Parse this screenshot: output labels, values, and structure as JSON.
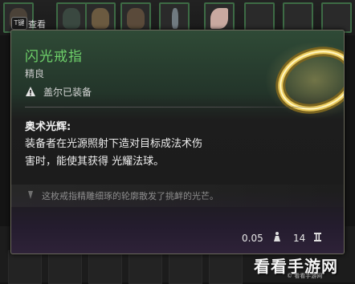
{
  "inventory": {
    "inspect_key": "T键",
    "inspect_label": "查看"
  },
  "tooltip": {
    "item_name": "闪光戒指",
    "rarity": "精良",
    "equipped_by": "盖尔已装备",
    "passive_title": "奥术光辉:",
    "passive_desc_line1": "装备者在光源照射下造对目标成法术伤",
    "passive_desc_line2_a": "害时，能使其获得 ",
    "passive_desc_keyword": "光耀法球。",
    "flavor_text": "这枚戒指精雕细琢的轮廓散发了挑衅的光芒。",
    "weight": "0.05",
    "price": "14",
    "icons": {
      "warning": "warning-triangle-icon",
      "quote": "quote-mark-icon",
      "weight": "weight-icon",
      "price": "gold-coin-icon"
    },
    "colors": {
      "item_name": "#6ed06a",
      "border": "#6b6a5c",
      "header_bg": "#2f4a36"
    }
  },
  "watermark": {
    "text": "看看手游网",
    "subtext": "© 看看手游网"
  }
}
